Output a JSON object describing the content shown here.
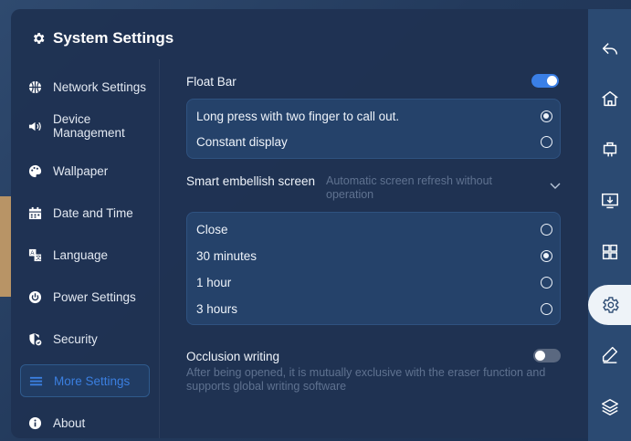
{
  "header": {
    "title": "System Settings",
    "icon": "gear-icon"
  },
  "sidebar": {
    "items": [
      {
        "label": "Network Settings",
        "icon": "globe-icon"
      },
      {
        "label": "Device Management",
        "icon": "speaker-icon"
      },
      {
        "label": "Wallpaper",
        "icon": "palette-icon"
      },
      {
        "label": "Date and Time",
        "icon": "calendar-icon"
      },
      {
        "label": "Language",
        "icon": "language-icon"
      },
      {
        "label": "Power Settings",
        "icon": "power-icon"
      },
      {
        "label": "Security",
        "icon": "shield-icon"
      },
      {
        "label": "More Settings",
        "icon": "menu-icon",
        "active": true
      },
      {
        "label": "About",
        "icon": "info-icon"
      }
    ]
  },
  "float_bar": {
    "label": "Float Bar",
    "enabled": true,
    "options": [
      {
        "label": "Long press with two finger to call out.",
        "selected": true
      },
      {
        "label": "Constant display",
        "selected": false
      }
    ]
  },
  "smart_embellish": {
    "label": "Smart embellish screen",
    "description": "Automatic screen refresh without operation",
    "options": [
      {
        "label": "Close",
        "selected": false
      },
      {
        "label": "30 minutes",
        "selected": true
      },
      {
        "label": "1 hour",
        "selected": false
      },
      {
        "label": "3 hours",
        "selected": false
      }
    ]
  },
  "occlusion_writing": {
    "label": "Occlusion writing",
    "enabled": false,
    "description": "After being opened, it is mutually exclusive with the eraser function and supports global writing software"
  },
  "right_toolbar": {
    "buttons": [
      "back-icon",
      "home-icon",
      "signal-source-icon",
      "screen-share-icon",
      "apps-icon",
      "settings-icon",
      "pen-icon",
      "layers-icon"
    ],
    "active": "settings-icon"
  },
  "colors": {
    "accent": "#3a7fe6",
    "panel": "#1f3252",
    "group": "#25426a"
  }
}
